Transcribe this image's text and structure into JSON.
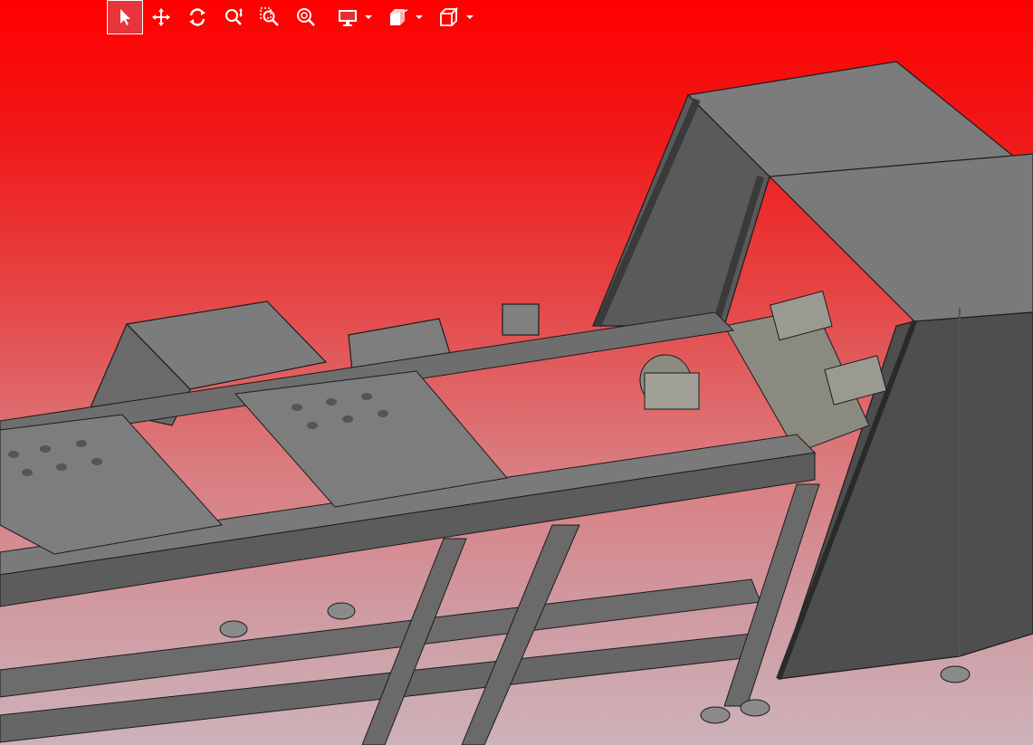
{
  "app": {
    "background_top": "#ff0000",
    "background_bottom": "#cdb2b9"
  },
  "toolbar": {
    "buttons": [
      {
        "name": "select-tool-button",
        "icon": "cursor-arrow-icon",
        "active": true
      },
      {
        "name": "pan-tool-button",
        "icon": "move-arrows-icon",
        "active": false
      },
      {
        "name": "rotate-tool-button",
        "icon": "rotate-icon",
        "active": false
      },
      {
        "name": "zoom-tool-button",
        "icon": "zoom-updown-icon",
        "active": false
      },
      {
        "name": "zoom-window-button",
        "icon": "zoom-window-icon",
        "active": false
      },
      {
        "name": "zoom-fit-button",
        "icon": "zoom-fit-icon",
        "active": false
      }
    ],
    "dropdowns": [
      {
        "name": "display-mode-dropdown",
        "icon": "monitor-icon"
      },
      {
        "name": "section-view-dropdown",
        "icon": "section-box-icon"
      },
      {
        "name": "standard-views-dropdown",
        "icon": "cube-icon"
      }
    ],
    "icon_color": "#ffffff",
    "active_color": "#e8343a"
  },
  "model": {
    "frame_color": "#6f6f6f",
    "panel_color": "#7b7b7b",
    "dark_panel_color": "#4d4d4d",
    "edge_color": "#1c1c1c"
  }
}
